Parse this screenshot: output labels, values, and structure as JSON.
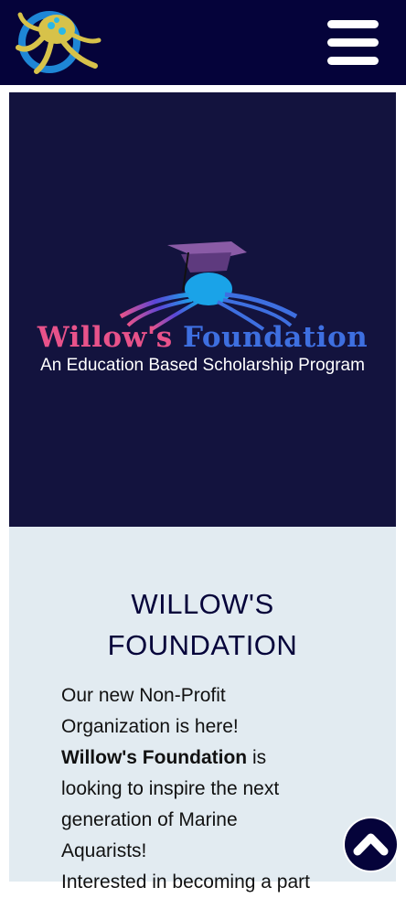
{
  "header": {
    "logo_icon": "octopus-logo-icon",
    "menu_icon": "hamburger-menu-icon"
  },
  "hero": {
    "logo_icon": "graduation-cap-octopus-icon",
    "title_part1": "Willow's",
    "title_part2": "Foundation",
    "subtitle": "An Education Based Scholarship Program"
  },
  "content": {
    "heading_line1": "WILLOW'S",
    "heading_line2": "FOUNDATION",
    "intro_line1": "Our new Non-Profit",
    "intro_line2": "Organization is here!",
    "intro_bold": "Willow's Foundation",
    "intro_after_bold": "is",
    "intro_line4": "looking to inspire the next",
    "intro_line5": "generation of Marine",
    "intro_line6": "Aquarists!",
    "intro_line7": "Interested in becoming a part"
  },
  "scroll_to_top": {
    "icon": "chevron-up-icon"
  },
  "colors": {
    "navy": "#05033a",
    "hero_bg": "#13133e",
    "content_bg": "#e2ebf1",
    "pink": "#e8528a",
    "blue": "#3e6fe0"
  }
}
